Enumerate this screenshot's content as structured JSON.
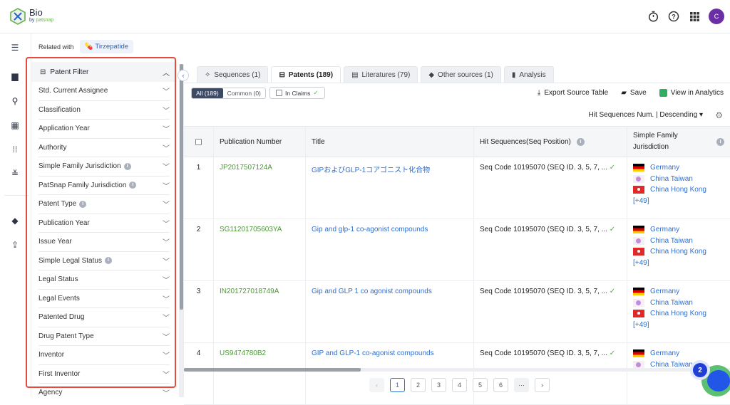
{
  "app": {
    "name": "Bio",
    "by": "by",
    "brand": "patsnap",
    "avatar_initial": "C"
  },
  "topbar": {
    "icons": [
      "timer-icon",
      "help-icon",
      "apps-grid-icon"
    ]
  },
  "related": {
    "label": "Related with",
    "chip": "Tirzepatide"
  },
  "filter": {
    "title": "Patent Filter",
    "items": [
      {
        "label": "Std. Current Assignee",
        "info": false
      },
      {
        "label": "Classification",
        "info": false
      },
      {
        "label": "Application Year",
        "info": false
      },
      {
        "label": "Authority",
        "info": false
      },
      {
        "label": "Simple Family Jurisdiction",
        "info": true
      },
      {
        "label": "PatSnap Family Jurisdiction",
        "info": true
      },
      {
        "label": "Patent Type",
        "info": true
      },
      {
        "label": "Publication Year",
        "info": false
      },
      {
        "label": "Issue Year",
        "info": false
      },
      {
        "label": "Simple Legal Status",
        "info": true
      },
      {
        "label": "Legal Status",
        "info": false
      },
      {
        "label": "Legal Events",
        "info": false
      },
      {
        "label": "Patented Drug",
        "info": false
      },
      {
        "label": "Drug Patent Type",
        "info": false
      },
      {
        "label": "Inventor",
        "info": false
      },
      {
        "label": "First Inventor",
        "info": false
      },
      {
        "label": "Agency",
        "info": false
      }
    ]
  },
  "tabs": [
    {
      "label": "Sequences (1)",
      "icon": "sequence-icon",
      "active": false
    },
    {
      "label": "Patents (189)",
      "icon": "patent-icon",
      "active": true
    },
    {
      "label": "Literatures (79)",
      "icon": "document-icon",
      "active": false
    },
    {
      "label": "Other sources (1)",
      "icon": "cube-icon",
      "active": false
    },
    {
      "label": "Analysis",
      "icon": "bar-chart-icon",
      "active": false
    }
  ],
  "toolbar": {
    "seg_all": "All (189)",
    "seg_common": "Common (0)",
    "in_claims": "In Claims",
    "export": "Export Source Table",
    "save": "Save",
    "analytics": "View in Analytics",
    "sort": "Hit Sequences Num. | Descending"
  },
  "table": {
    "headers": [
      "Publication Number",
      "Title",
      "Hit Sequences(Seq Position)",
      "Simple Family Jurisdiction"
    ],
    "rows": [
      {
        "index": "1",
        "pub": "JP2017507124A",
        "title": "GIPおよびGLP-1コアゴニスト化合物",
        "seq": "Seq Code 10195070 (SEQ ID. 3, 5, 7, ...",
        "juris": [
          "Germany",
          "China Taiwan",
          "China Hong Kong"
        ],
        "more": "[+49]"
      },
      {
        "index": "2",
        "pub": "SG11201705603YA",
        "title": "Gip and glp-1 co-agonist compounds",
        "seq": "Seq Code 10195070 (SEQ ID. 3, 5, 7, ...",
        "juris": [
          "Germany",
          "China Taiwan",
          "China Hong Kong"
        ],
        "more": "[+49]"
      },
      {
        "index": "3",
        "pub": "IN201727018749A",
        "title": "Gip and GLP 1 co agonist compounds",
        "seq": "Seq Code 10195070 (SEQ ID. 3, 5, 7, ...",
        "juris": [
          "Germany",
          "China Taiwan",
          "China Hong Kong"
        ],
        "more": "[+49]"
      },
      {
        "index": "4",
        "pub": "US9474780B2",
        "title": "GIP and GLP-1 co-agonist compounds",
        "seq": "Seq Code 10195070 (SEQ ID. 3, 5, 7, ...",
        "juris": [
          "Germany",
          "China Taiwan"
        ],
        "more": ""
      }
    ]
  },
  "pagination": {
    "pages": [
      "1",
      "2",
      "3",
      "4",
      "5",
      "6"
    ],
    "ellipsis": "···",
    "current": "1"
  },
  "assistant": {
    "badge": "2"
  },
  "colors": {
    "accent": "#2f6fd1",
    "pub_number": "#4a9a33",
    "highlight_box": "#e54b3a",
    "avatar": "#6a2ea5"
  }
}
